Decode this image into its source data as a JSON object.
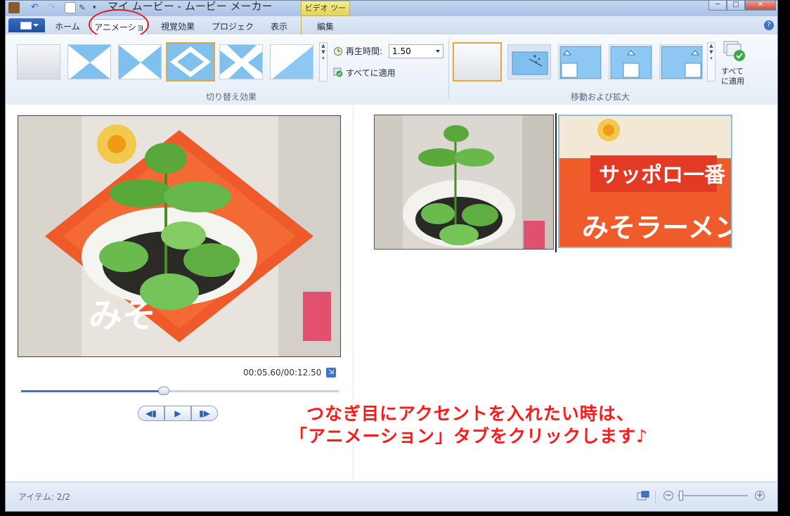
{
  "window": {
    "title": "マイ ムービー - ムービー メーカー",
    "context_tab_group": "ビデオ ツール",
    "controls": {
      "minimize": "─",
      "maximize": "□",
      "close": "✕"
    }
  },
  "tabs": {
    "home": "ホーム",
    "animation": "アニメーション",
    "visual_effects": "視覚効果",
    "project": "プロジェクト",
    "view": "表示",
    "edit": "編集"
  },
  "ribbon": {
    "transitions_group_label": "切り替え効果",
    "duration_label": "再生時間:",
    "duration_value": "1.50",
    "apply_all_label": "すべてに適用",
    "pan_zoom_group_label": "移動および拡大",
    "apply_all_big_label_line1": "すべて",
    "apply_all_big_label_line2": "に適用"
  },
  "player": {
    "time_display": "00:05.60/00:12.50",
    "progress": 0.45
  },
  "annotation": {
    "line1": "つなぎ目にアクセントを入れたい時は、",
    "line2": "「アニメーション」タブをクリックします♪",
    "color": "#ff1a1a"
  },
  "status": {
    "items_label": "アイテム: 2/2"
  },
  "colors": {
    "accent": "#3f73c7",
    "selection": "#e3a93c",
    "highlight_circle": "#e01c1c"
  }
}
